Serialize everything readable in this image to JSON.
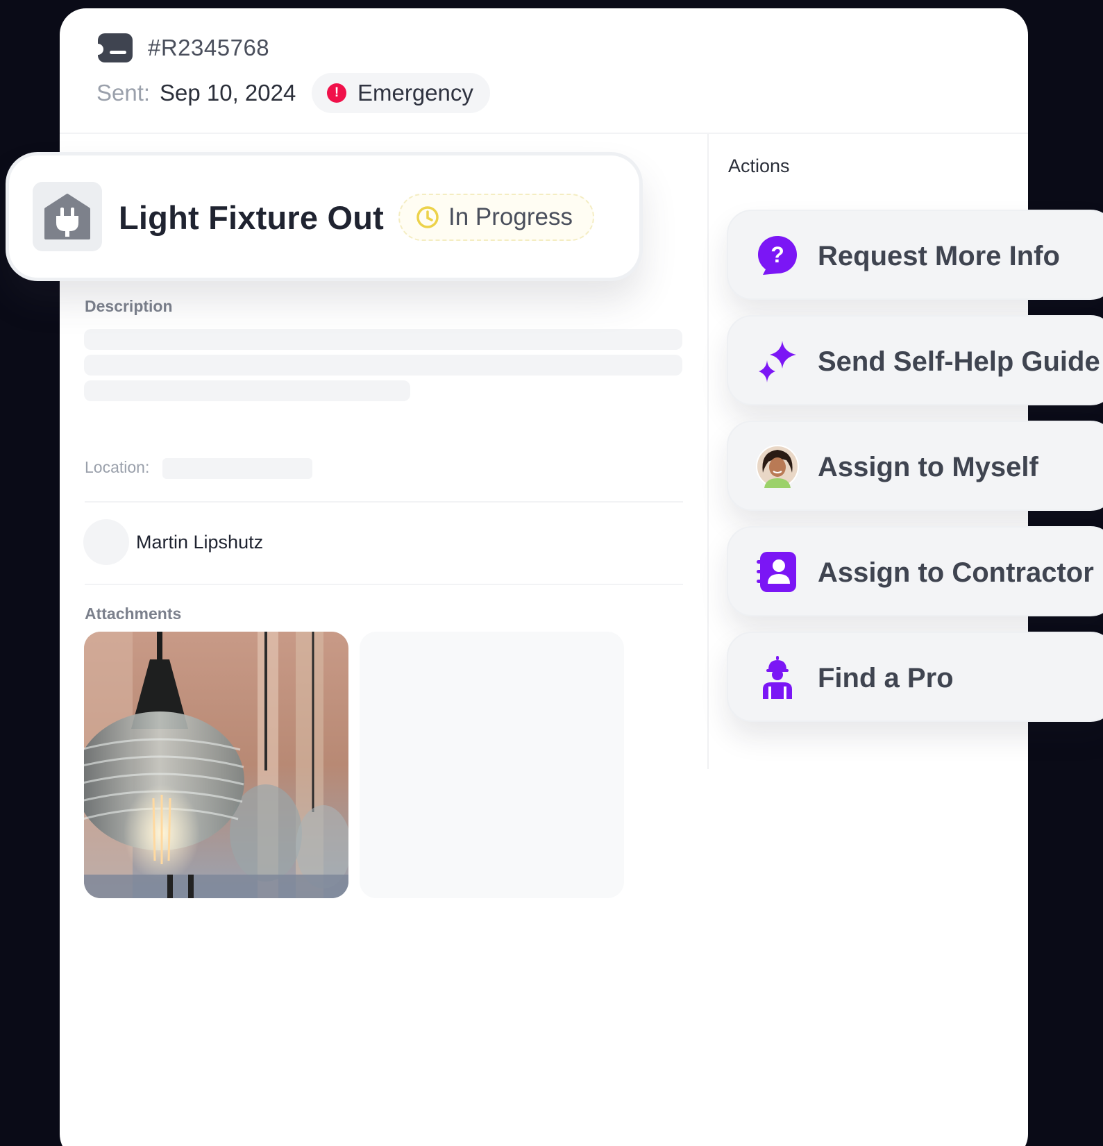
{
  "ticket": {
    "id": "#R2345768",
    "sent_label": "Sent:",
    "sent_date": "Sep 10, 2024",
    "priority": "Emergency",
    "priority_color": "#f0114a"
  },
  "title_card": {
    "title": "Light Fixture Out",
    "status": "In Progress",
    "category_icon": "plug-icon"
  },
  "details": {
    "description_label": "Description",
    "location_label": "Location:",
    "reporter_name": "Martin Lipshutz",
    "attachments_label": "Attachments"
  },
  "actions": {
    "heading": "Actions",
    "accent_color": "#7b16f5",
    "items": [
      {
        "label": "Request More Info",
        "icon": "question-bubble-icon"
      },
      {
        "label": "Send Self-Help Guide",
        "icon": "sparkle-icon"
      },
      {
        "label": "Assign to Myself",
        "icon": "user-avatar-icon"
      },
      {
        "label": "Assign to Contractor",
        "icon": "contact-book-icon"
      },
      {
        "label": "Find a Pro",
        "icon": "worker-icon"
      }
    ]
  }
}
